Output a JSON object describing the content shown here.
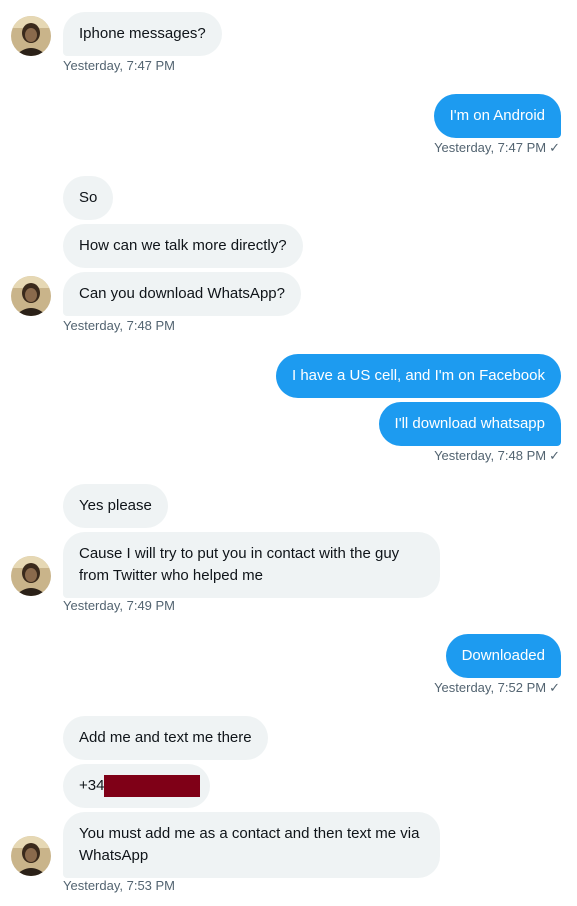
{
  "colors": {
    "incoming_bubble": "#eff3f4",
    "outgoing_bubble": "#1d9bf0",
    "timestamp": "#536471",
    "redaction": "#7f0017"
  },
  "icons": {
    "read_receipt": "checkmark-icon",
    "avatar": "user-avatar-photo"
  },
  "messages": {
    "m1": "Iphone messages?",
    "m2": "I'm on Android",
    "m3": "So",
    "m4": "How can we talk more directly?",
    "m5": "Can you download WhatsApp?",
    "m6": "I have a US cell, and I'm on Facebook",
    "m7": "I'll download whatsapp",
    "m8": "Yes please",
    "m9": "Cause I will try to put you in contact with the guy from Twitter who helped me",
    "m10": "Downloaded",
    "m11": "Add me and text me there",
    "m12_prefix": "+34",
    "m13": "You must add me as a contact and then text me via WhatsApp"
  },
  "timestamps": {
    "t1": "Yesterday, 7:47 PM",
    "t2": "Yesterday, 7:47 PM",
    "t3": "Yesterday, 7:48 PM",
    "t4": "Yesterday, 7:48 PM",
    "t5": "Yesterday, 7:49 PM",
    "t6": "Yesterday, 7:52 PM",
    "t7": "Yesterday, 7:53 PM"
  },
  "read_receipt_glyph": "✓"
}
